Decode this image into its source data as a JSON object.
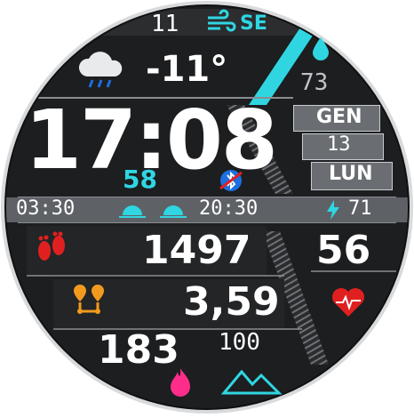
{
  "weather": {
    "wind_speed": "11",
    "wind_direction": "SE",
    "temperature": "-11°",
    "humidity": "73",
    "icon": "cloud-rain-icon"
  },
  "time": {
    "hours_minutes": "17:08",
    "seconds": "58"
  },
  "date": {
    "month": "GEN",
    "day": "13",
    "weekday": "LUN"
  },
  "sun": {
    "sunrise": "03:30",
    "sunset": "20:30"
  },
  "battery": {
    "percent": "71"
  },
  "activity": {
    "steps": "1497",
    "heart_rate": "56",
    "distance": "3,59",
    "calories": "183",
    "floors": "100"
  },
  "colors": {
    "accent_cyan": "#2fd6e2",
    "heart_red": "#e02020",
    "steps_red": "#e02020",
    "distance_orange": "#f39a1e",
    "calories_pink": "#ff2d8a",
    "bluetooth_blue": "#1e6fe0",
    "face_dark": "#1c1e20"
  }
}
